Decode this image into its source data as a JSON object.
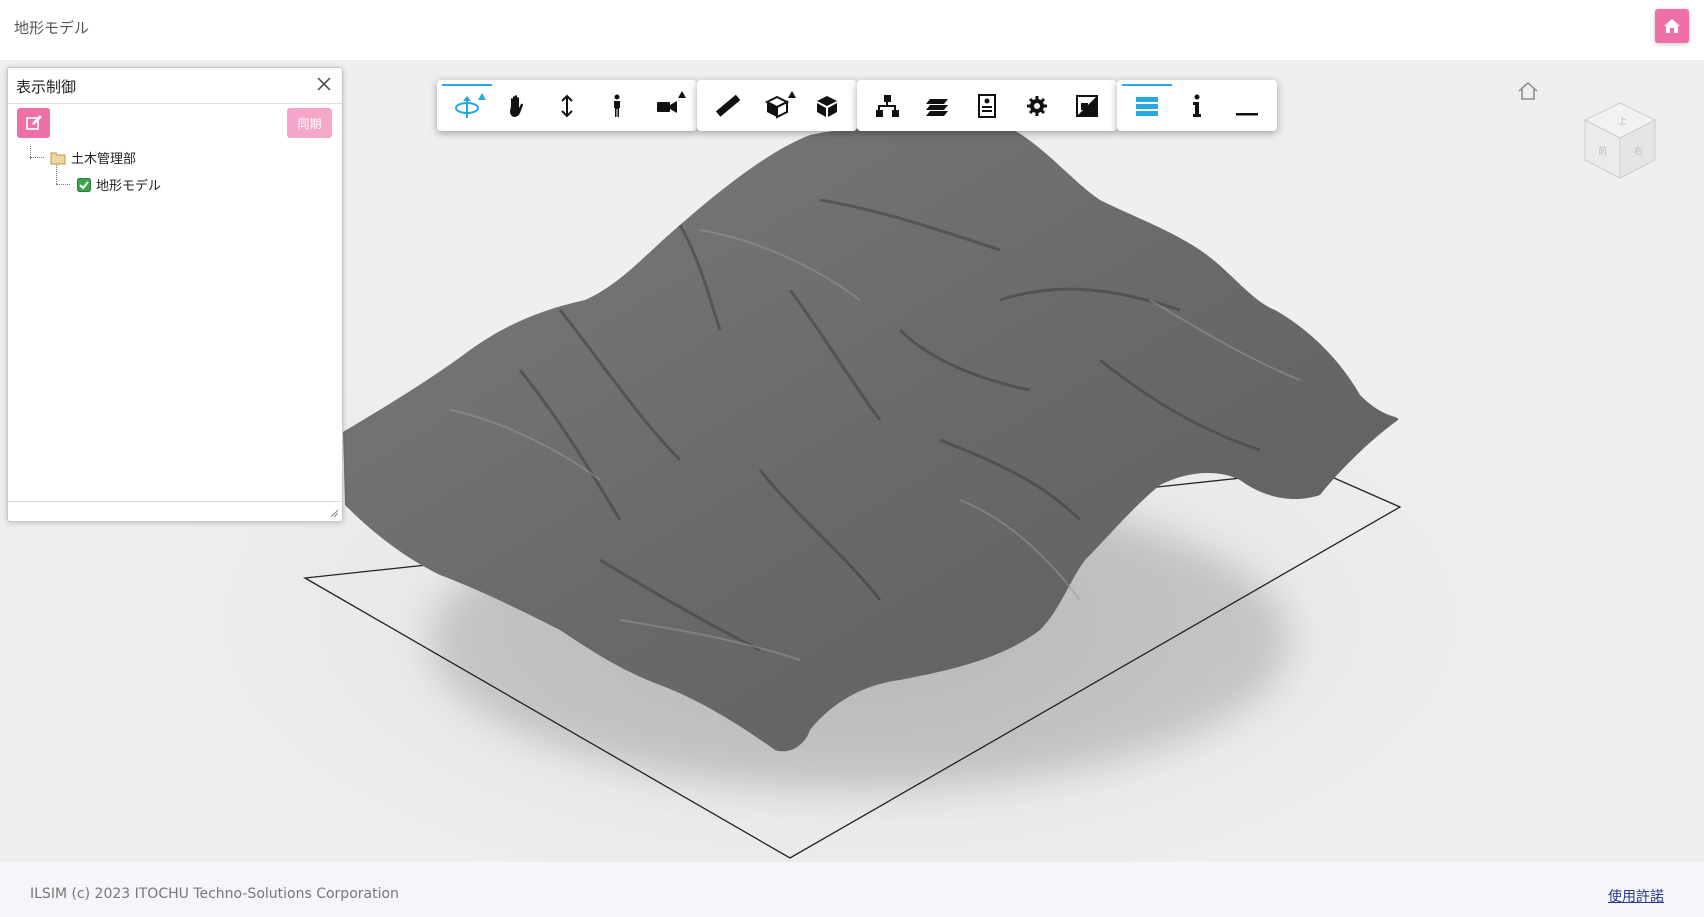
{
  "header": {
    "title": "地形モデル",
    "home_icon": "home-icon"
  },
  "panel": {
    "title": "表示制御",
    "sync_label": "同期",
    "tree": [
      {
        "label": "土木管理部",
        "icon": "folder-icon",
        "checked": null
      },
      {
        "label": "地形モデル",
        "icon": "checkbox-icon",
        "checked": true
      }
    ]
  },
  "toolbar": {
    "groups": [
      [
        "orbit-icon",
        "pan-hand-icon",
        "vertical-move-icon",
        "walk-person-icon",
        "camera-icon"
      ],
      [
        "measure-ruler-icon",
        "section-box-icon",
        "cube-icon"
      ],
      [
        "tree-hierarchy-icon",
        "layers-icon",
        "properties-icon",
        "settings-gear-icon",
        "render-mode-icon"
      ],
      [
        "list-panel-icon",
        "info-icon",
        "minimize-icon"
      ]
    ]
  },
  "viewcube": {
    "top": "上",
    "front": "前",
    "right": "右"
  },
  "footer": {
    "copyright": "ILSIM (c) 2023 ITOCHU Techno-Solutions Corporation",
    "license_link": "使用許諾"
  },
  "colors": {
    "accent_pink": "#ef6fa8",
    "sync_pink": "#f4a7c9",
    "active_blue": "#26a8e0",
    "terrain": "#6f6f6f"
  }
}
